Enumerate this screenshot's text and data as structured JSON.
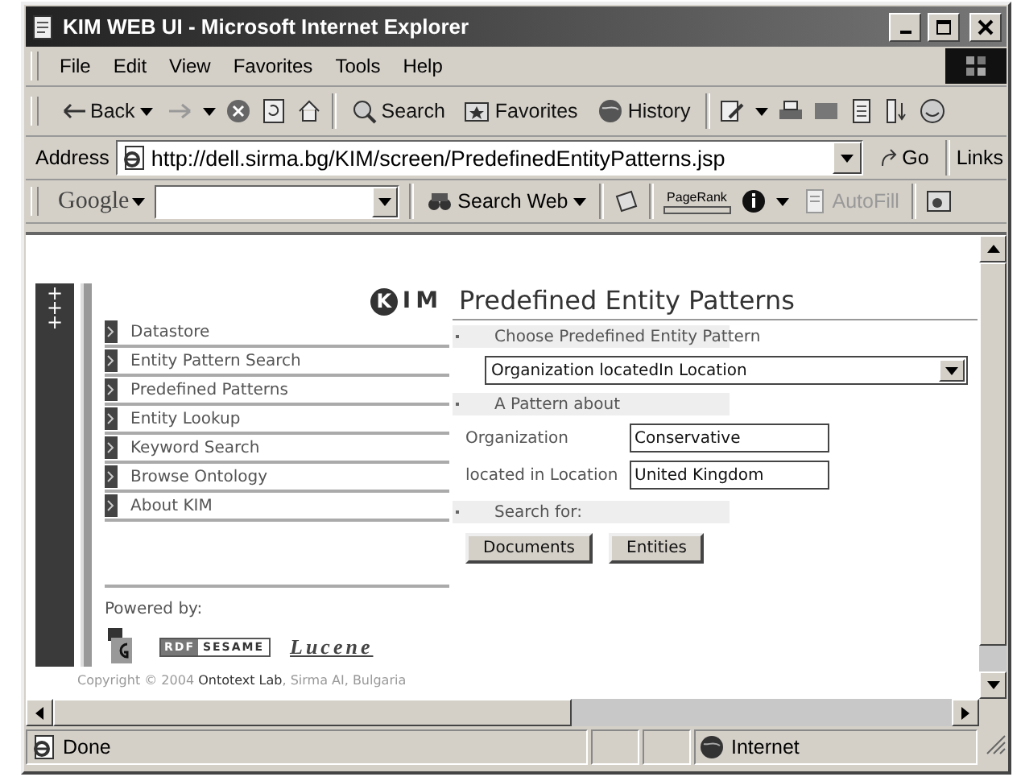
{
  "window": {
    "title": "KIM WEB UI - Microsoft Internet Explorer"
  },
  "menu": [
    "File",
    "Edit",
    "View",
    "Favorites",
    "Tools",
    "Help"
  ],
  "toolbar": {
    "back": "Back",
    "search": "Search",
    "favorites": "Favorites",
    "history": "History"
  },
  "address": {
    "label": "Address",
    "url": "http://dell.sirma.bg/KIM/screen/PredefinedEntityPatterns.jsp",
    "go": "Go",
    "links": "Links"
  },
  "google_bar": {
    "logo": "Google",
    "search_button": "Search Web",
    "pagerank": "PageRank",
    "autofill": "AutoFill",
    "autofill_disabled": true
  },
  "page": {
    "side_marks": [
      "+",
      "+",
      "+"
    ],
    "logo": [
      "K",
      "IM"
    ],
    "title": "Predefined Entity Patterns",
    "nav": [
      "Datastore",
      "Entity Pattern Search",
      "Predefined Patterns",
      "Entity Lookup",
      "Keyword Search",
      "Browse Ontology",
      "About KIM"
    ],
    "powered_by": "Powered by:",
    "sesame_logo": [
      "RDF",
      "SESAME"
    ],
    "lucene_logo": "Lucene",
    "copyright": "Copyright © 2004 **Ontotext Lab**, Sirma AI, Bulgaria",
    "pattern_label": "Choose Predefined Entity Pattern",
    "pattern_select": "Organization locatedIn Location",
    "about_label": "A Pattern about",
    "fields": [
      {
        "label": "Organization",
        "value": "Conservative"
      },
      {
        "label": "located in Location",
        "value": "United Kingdom"
      }
    ],
    "search_label": "Search for:",
    "buttons": [
      "Documents",
      "Entities"
    ]
  },
  "status_bar": {
    "text": "Done",
    "zone": "Internet"
  }
}
